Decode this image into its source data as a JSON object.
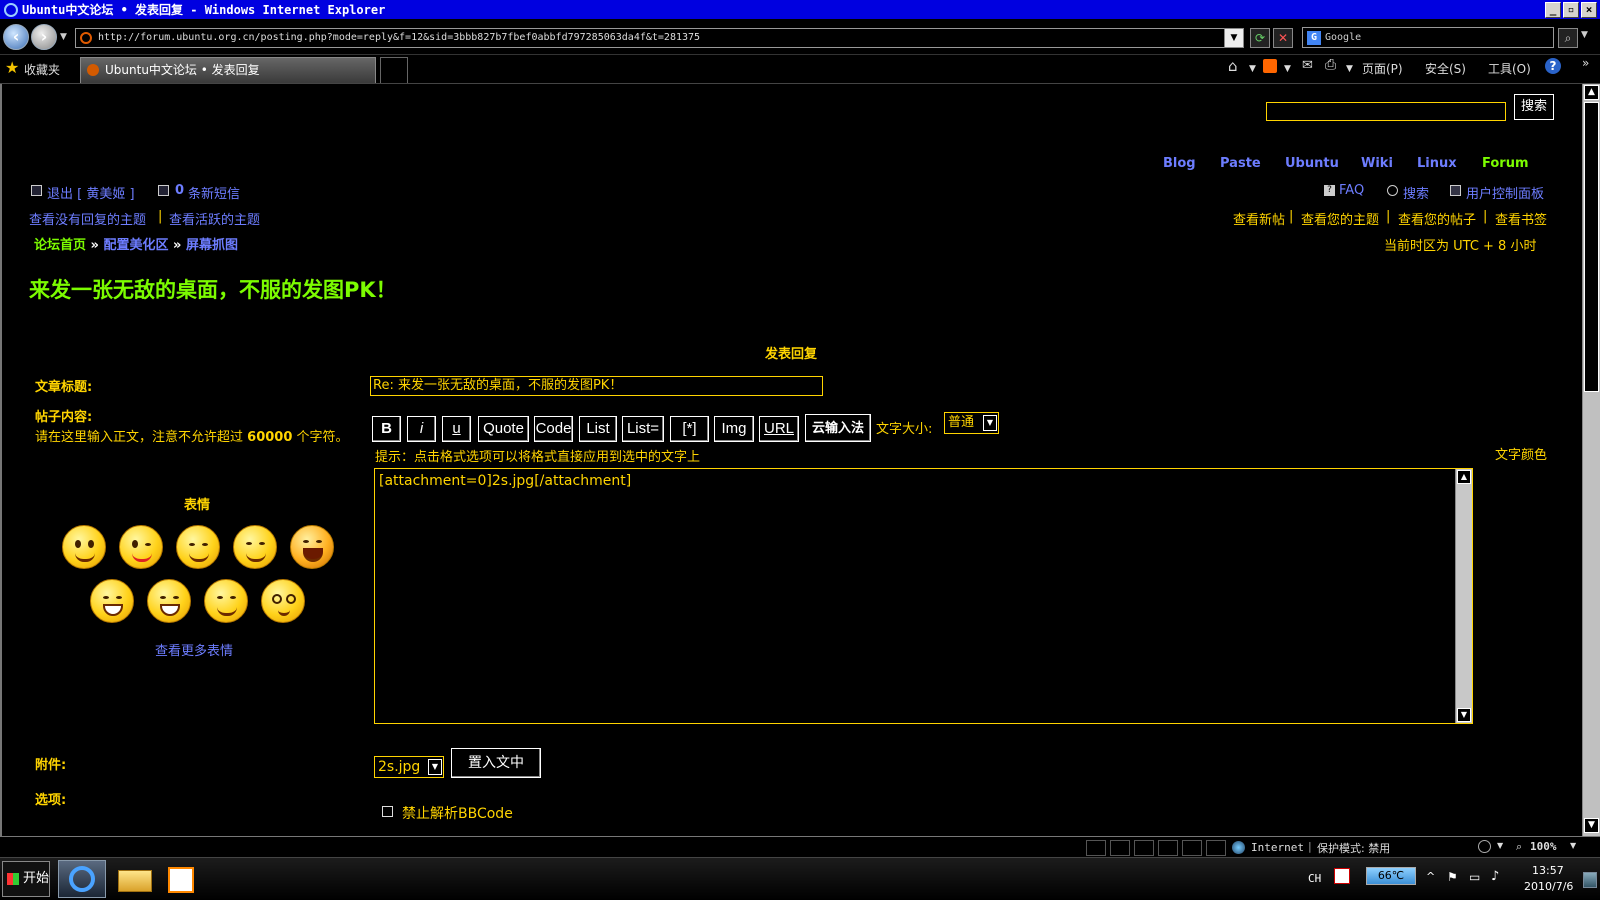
{
  "window": {
    "title": "Ubuntu中文论坛 • 发表回复 - Windows Internet Explorer",
    "controls": {
      "min": "_",
      "max": "▫",
      "close": "×"
    }
  },
  "browser": {
    "url": "http://forum.ubuntu.org.cn/posting.php?mode=reply&f=12&sid=3bbb827b7fbef0abbfd797285063da4f&t=281375",
    "search_provider": "Google",
    "favorites_label": "收藏夹",
    "tab_title": "Ubuntu中文论坛 • 发表回复",
    "commands": {
      "page": "页面(P)",
      "safety": "安全(S)",
      "tools": "工具(O)"
    }
  },
  "forum": {
    "search_button": "搜索",
    "search_value": "",
    "topnav": [
      "Blog",
      "Paste",
      "Ubuntu",
      "Wiki",
      "Linux",
      "Forum"
    ],
    "logout": "退出 [ 黄美姬 ]",
    "pm_count": "0",
    "pm_label": "条新短信",
    "faq": "FAQ",
    "search_link": "搜索",
    "ucp": "用户控制面板",
    "unanswered": "查看没有回复的主题",
    "sep": "|",
    "active": "查看活跃的主题",
    "right_links": [
      "查看新帖",
      "查看您的主题",
      "查看您的帖子",
      "查看书签"
    ],
    "breadcrumb": {
      "home": "论坛首页",
      "sep": "»",
      "cat": "配置美化区",
      "sub": "屏幕抓图"
    },
    "timezone": "当前时区为 UTC + 8 小时",
    "topic_title": "来发一张无敌的桌面，不服的发图PK！"
  },
  "post_form": {
    "heading": "发表回复",
    "subject_label": "文章标题:",
    "subject_value": "Re: 来发一张无敌的桌面，不服的发图PK！",
    "body_label": "帖子内容:",
    "body_hint_prefix": "请在这里输入正文，注意不允许超过",
    "body_hint_number": "60000",
    "body_hint_suffix": "个字符。",
    "buttons": [
      "B",
      "i",
      "u",
      "Quote",
      "Code",
      "List",
      "List=",
      "[*]",
      "Img",
      "URL"
    ],
    "ime_button": "云输入法",
    "fontsize_label": "文字大小:",
    "fontsize_value": "普通",
    "tip": "提示：点击格式选项可以将格式直接应用到选中的文字上",
    "color_label": "文字颜色",
    "message": "[attachment=0]2s.jpg[/attachment]",
    "smilies_title": "表情",
    "more_smilies": "查看更多表情",
    "attachment_label": "附件:",
    "attachment_select": "2s.jpg",
    "place_inline": "置入文中",
    "options_label": "选项:",
    "disable_bbcode": "禁止解析BBCode"
  },
  "status": {
    "zone": "Internet",
    "protected_mode": "保护模式: 禁用",
    "zoom": "100%"
  },
  "taskbar": {
    "start": "开始",
    "lang": "CH",
    "temp": "66℃",
    "time": "13:57",
    "date": "2010/7/6"
  }
}
